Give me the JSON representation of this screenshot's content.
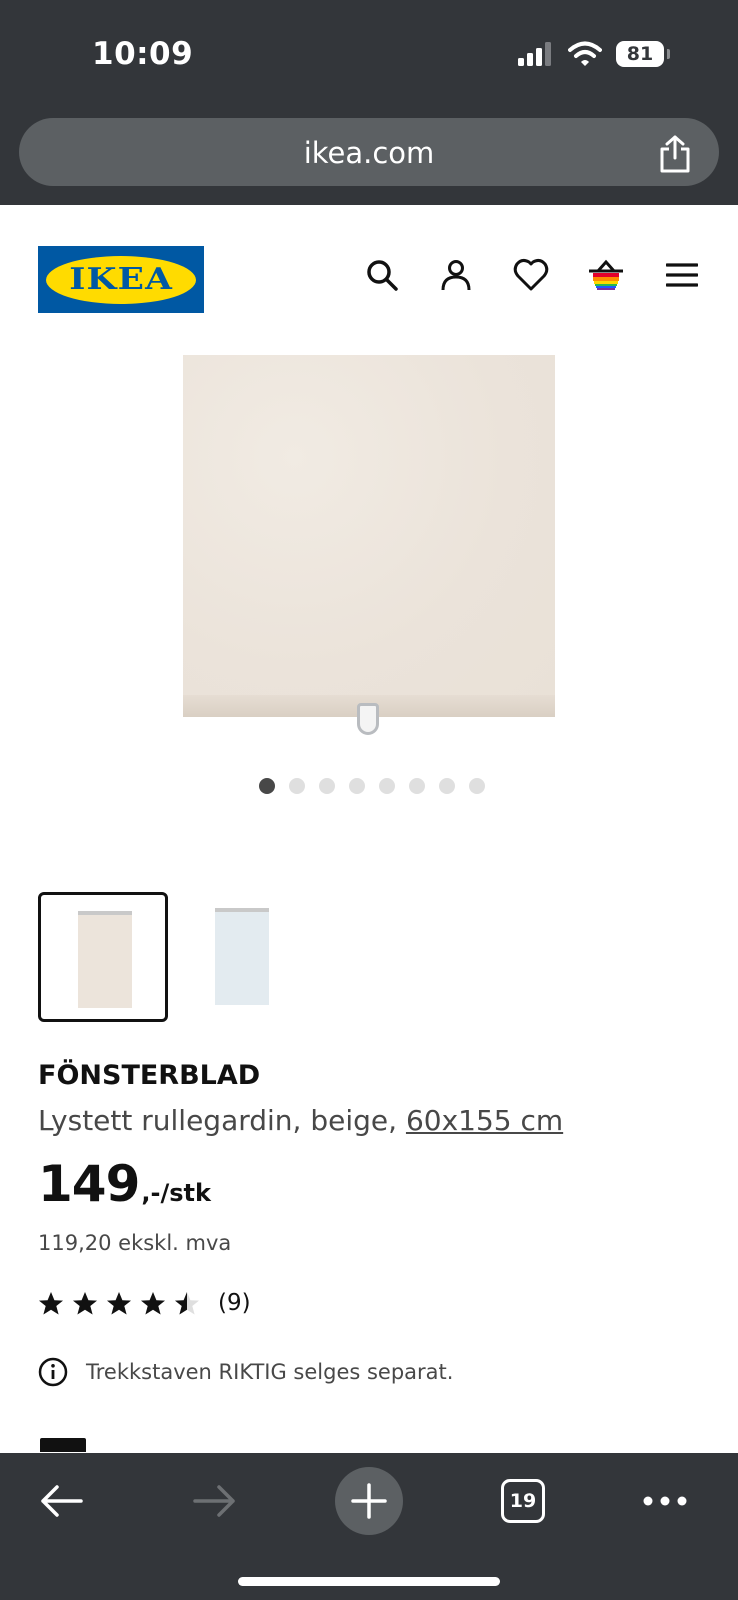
{
  "status_bar": {
    "time": "10:09",
    "battery": "81"
  },
  "browser": {
    "url": "ikea.com",
    "tab_count": "19"
  },
  "header": {
    "logo_text": "IKEA",
    "icons": [
      "search-icon",
      "account-icon",
      "heart-icon",
      "basket-icon",
      "menu-icon"
    ]
  },
  "gallery": {
    "image_count": 8,
    "active_index": 0
  },
  "variants": [
    {
      "color": "beige",
      "selected": true
    },
    {
      "color": "light blue",
      "selected": false
    }
  ],
  "product": {
    "name": "FÖNSTERBLAD",
    "description": "Lystett rullegardin, beige, ",
    "size": "60x155 cm",
    "price": "149",
    "price_suffix": ",-/stk",
    "price_ex_vat": "119,20 ekskl. mva",
    "rating": 4.5,
    "rating_max": 5,
    "review_count": "(9)",
    "info_note": "Trekkstaven RIKTIG selges separat."
  },
  "colors": {
    "chrome": "#33363a",
    "logo_blue": "#0058a3",
    "logo_yellow": "#ffdb00"
  }
}
